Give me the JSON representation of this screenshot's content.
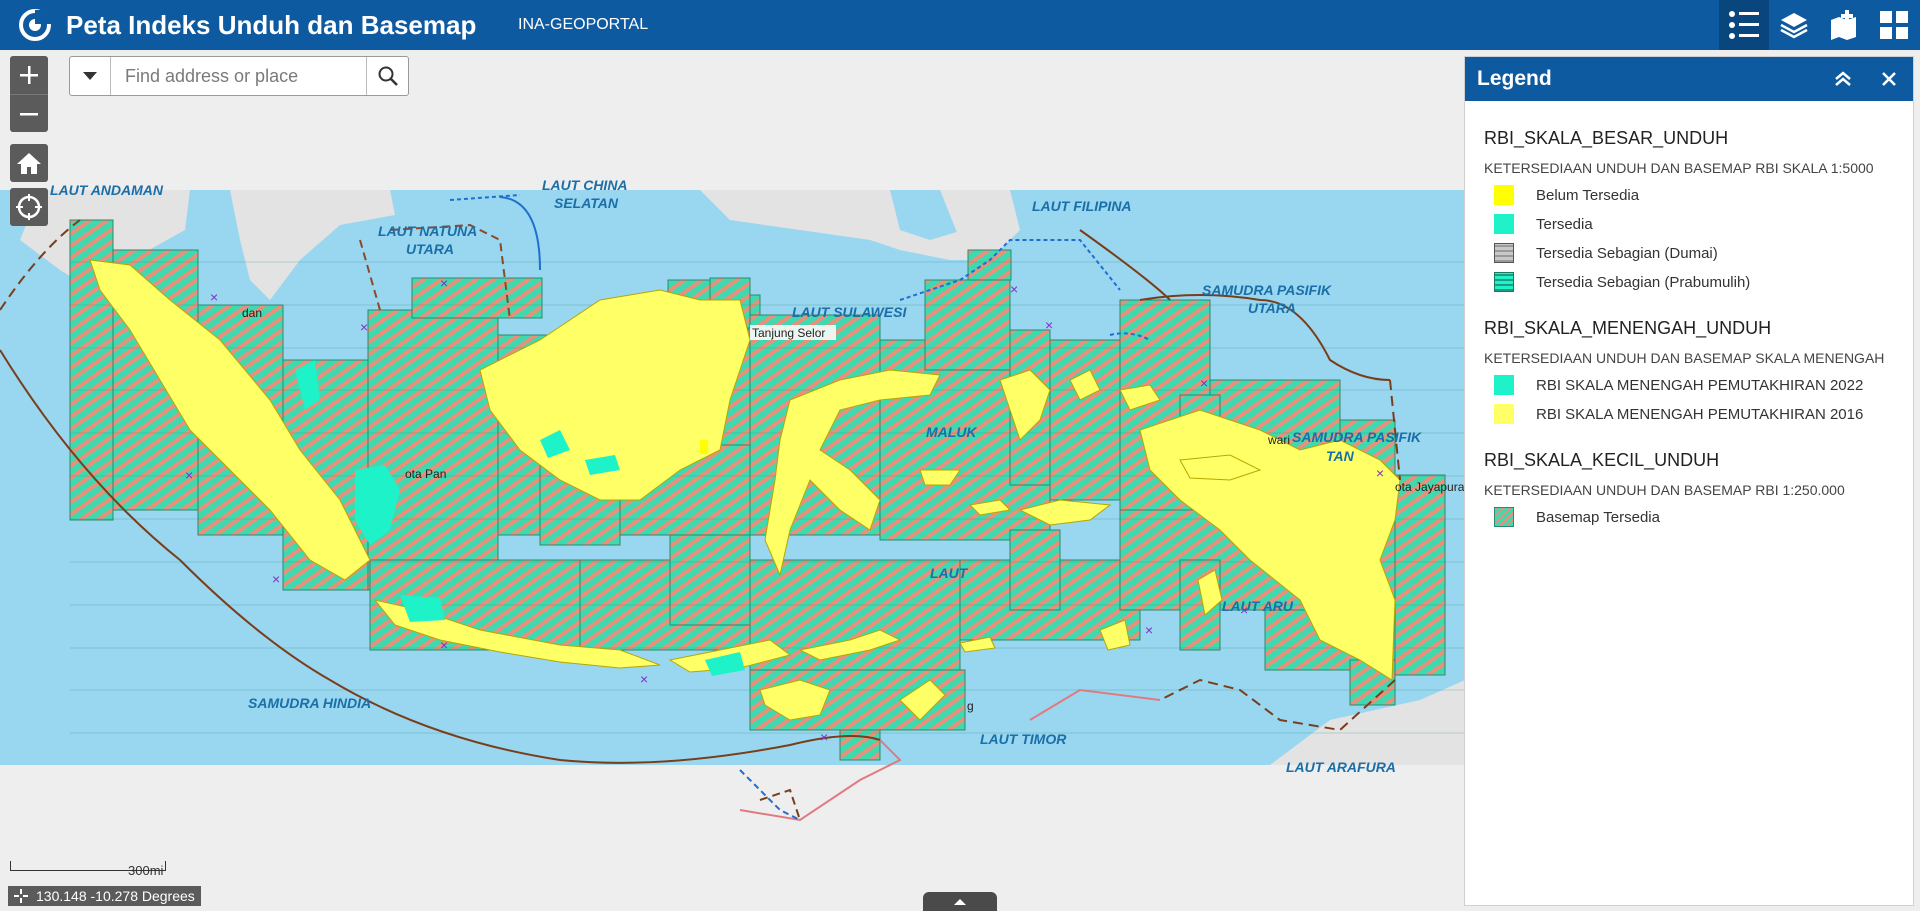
{
  "header": {
    "title": "Peta Indeks Unduh dan Basemap",
    "subtitle": "INA-GEOPORTAL"
  },
  "search": {
    "placeholder": "Find address or place"
  },
  "legend": {
    "title": "Legend",
    "groups": [
      {
        "layer": "RBI_SKALA_BESAR_UNDUH",
        "desc": "KETERSEDIAAN UNDUH DAN BASEMAP RBI SKALA 1:5000",
        "items": [
          {
            "label": "Belum Tersedia",
            "color": "#ffff00"
          },
          {
            "label": "Tersedia",
            "color": "#1ef2c8"
          },
          {
            "label": "Tersedia Sebagian (Dumai)",
            "color": "#b0b0b0"
          },
          {
            "label": "Tersedia Sebagian (Prabumulih)",
            "color": "#1ef2c8"
          }
        ]
      },
      {
        "layer": "RBI_SKALA_MENENGAH_UNDUH",
        "desc": "KETERSEDIAAN UNDUH DAN BASEMAP SKALA MENENGAH",
        "items": [
          {
            "label": "RBI SKALA MENENGAH PEMUTAKHIRAN 2022",
            "color": "#1ef2c8"
          },
          {
            "label": "RBI SKALA MENENGAH PEMUTAKHIRAN 2016",
            "color": "#ffff66"
          }
        ]
      },
      {
        "layer": "RBI_SKALA_KECIL_UNDUH",
        "desc": "KETERSEDIAAN UNDUH DAN BASEMAP RBI 1:250.000",
        "items": [
          {
            "label": "Basemap Tersedia",
            "color": "#3fd9b0"
          }
        ]
      }
    ]
  },
  "map": {
    "sea_labels": {
      "andaman": "LAUT ANDAMAN",
      "china1": "LAUT CHINA",
      "china2": "SELATAN",
      "natuna1": "LAUT NATUNA",
      "natuna2": "UTARA",
      "filipina": "LAUT FILIPINA",
      "sulawesi": "LAUT SULAWESI",
      "pasifik1": "SAMUDRA PASIFIK",
      "pasifik2": "UTARA",
      "pasifik3": "SAMUDRA PASIFIK",
      "pasifik4": "TAN",
      "maluku": "MALUK",
      "banda": "LAUT",
      "aru": "LAUT ARU",
      "hindia": "SAMUDRA HINDIA",
      "timor": "LAUT TIMOR",
      "arafura": "LAUT ARAFURA"
    },
    "cities": {
      "medan": "dan",
      "tanjung_selor": "Tanjung Selor",
      "padang": "ota Pan",
      "jayapura": "ota Jayapura",
      "sorong": "wari",
      "kupang": "g"
    },
    "scale_label": "300mi",
    "coordinates": "130.148 -10.278 Degrees"
  },
  "colors": {
    "header_bg": "#0e5aa0",
    "sea": "#99d6ef",
    "land_grey": "#e3e3e3",
    "index_green": "#3fd9b0",
    "hatch_red": "#e8907a",
    "land_yellow": "#ffff66",
    "cyan": "#1ef2c8"
  }
}
